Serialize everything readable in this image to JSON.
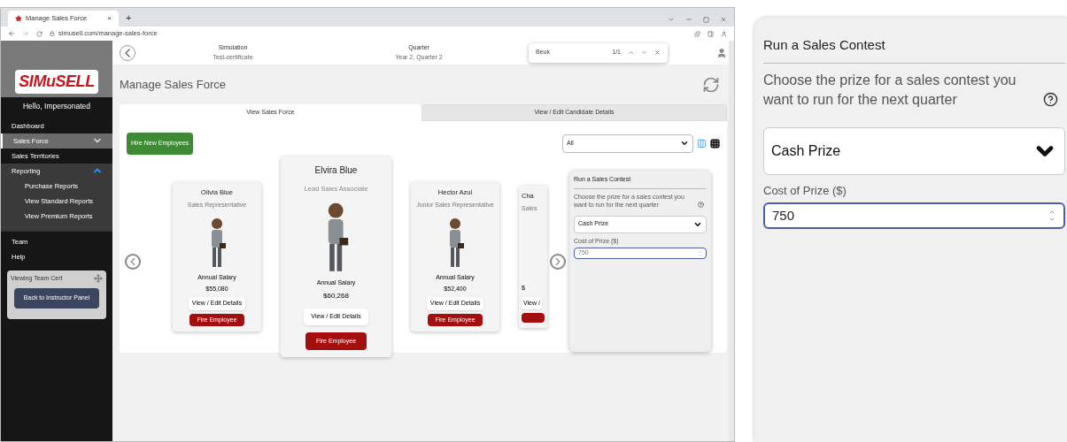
{
  "browser": {
    "tab_title": "Manage Sales Force",
    "tab_close": "×",
    "new_tab": "+",
    "url": "simusell.com/manage-sales-force"
  },
  "header": {
    "simulation_label": "Simulation",
    "simulation": "Test-certificate",
    "quarter_label": "Quarter",
    "quarter": "Year 2, Quarter 2",
    "find_value": "Beuk",
    "find_count": "1/1"
  },
  "sidebar": {
    "logo": "SIMuSELL",
    "greeting": "Hello, Impersonated",
    "items": [
      {
        "label": "Dashboard",
        "selected": false
      },
      {
        "label": "Sales Force",
        "selected": true,
        "expanded": false
      },
      {
        "label": "Sales Territories",
        "selected": false
      },
      {
        "label": "Reporting",
        "selected": false,
        "expanded": true,
        "children": [
          {
            "label": "Purchase Reports",
            "selected": false
          },
          {
            "label": "View Standard Reports",
            "selected": false
          },
          {
            "label": "View Premium Reports",
            "selected": false
          }
        ]
      },
      {
        "label": "Team",
        "selected": false
      },
      {
        "label": "Help",
        "selected": false
      }
    ],
    "viewing": {
      "label": "Viewing Team Cert",
      "button": "Back to Instructor Panel"
    }
  },
  "page_title": "Manage Sales Force",
  "tabs": [
    {
      "label": "View Sales Force",
      "selected": true
    },
    {
      "label": "View / Edit Candidate Details",
      "selected": false
    }
  ],
  "hire_button": "Hire New Employees",
  "filter": {
    "value": "All"
  },
  "cards": [
    {
      "name": "Olivia Blue",
      "role": "Sales Representative",
      "salary_label": "Annual Salary",
      "salary": "$55,080",
      "details_button": "View / Edit Details",
      "fire_button": "Fire Employee",
      "featured": false
    },
    {
      "name": "Elvira Blue",
      "role": "Lead Sales Associate",
      "salary_label": "Annual Salary",
      "salary": "$60,268",
      "details_button": "View / Edit Details",
      "fire_button": "Fire Employee",
      "featured": true
    },
    {
      "name": "Hector Azul",
      "role": "Junior Sales Representative",
      "salary_label": "Annual Salary",
      "salary": "$52,400",
      "details_button": "View / Edit Details",
      "fire_button": "Fire Employee",
      "featured": false
    },
    {
      "name": "Cha",
      "role": "Sales",
      "salary": "$",
      "details_button": "View /",
      "featured": false
    }
  ],
  "contest_popup": {
    "title": "Run a Sales Contest",
    "description": "Choose the prize for a sales contest you want to run for the next quarter",
    "prize": "Cash Prize",
    "cost_label": "Cost of Prize ($)",
    "cost": "750"
  },
  "contest_zoom": {
    "title": "Run a Sales Contest",
    "description": "Choose the prize for a sales contest you want to run for the next quarter",
    "prize": "Cash Prize",
    "cost_label": "Cost of Prize ($)",
    "cost": "750"
  }
}
